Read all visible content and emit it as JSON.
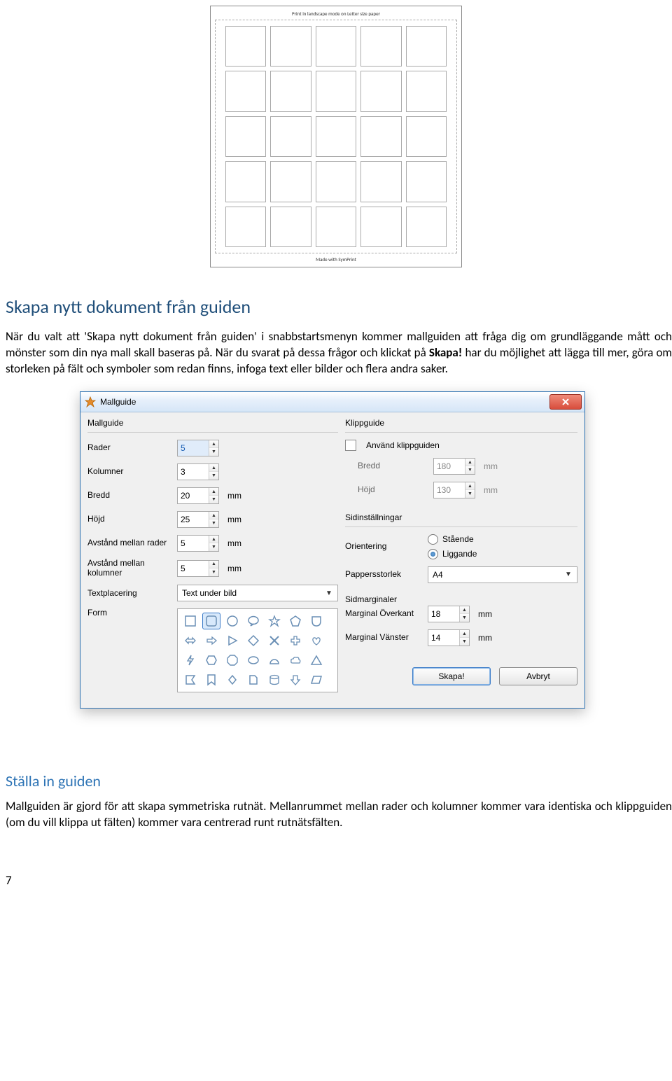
{
  "preview": {
    "header": "Print in landscape mode on Letter size paper",
    "footer": "Made with SymPrint"
  },
  "section1": {
    "heading": "Skapa nytt dokument från guiden",
    "para_before": "När du valt att 'Skapa nytt dokument från guiden' i snabbstartsmenyn kommer mallguiden att fråga dig om grundläggande mått och mönster som din nya mall skall baseras på. När du svarat på dessa frågor och klickat på ",
    "para_bold": "Skapa!",
    "para_after": " har du möjlighet att lägga till mer, göra om storleken på fält och symboler som redan finns, infoga text eller bilder och flera andra saker."
  },
  "dialog": {
    "title": "Mallguide",
    "left": {
      "group": "Mallguide",
      "rows_label": "Rader",
      "rows_value": "5",
      "cols_label": "Kolumner",
      "cols_value": "3",
      "width_label": "Bredd",
      "width_value": "20",
      "height_label": "Höjd",
      "height_value": "25",
      "rowgap_label": "Avstånd mellan rader",
      "rowgap_value": "5",
      "colgap_label": "Avstånd mellan kolumner",
      "colgap_value": "5",
      "textpos_label": "Textplacering",
      "textpos_value": "Text under bild",
      "form_label": "Form",
      "unit_mm": "mm"
    },
    "right": {
      "cut_group": "Klippguide",
      "cut_use_label": "Använd klippguiden",
      "cut_width_label": "Bredd",
      "cut_width_value": "180",
      "cut_height_label": "Höjd",
      "cut_height_value": "130",
      "page_group": "Sidinställningar",
      "orient_label": "Orientering",
      "orient_portrait": "Stående",
      "orient_landscape": "Liggande",
      "paper_label": "Pappersstorlek",
      "paper_value": "A4",
      "margin_group": "Sidmarginaler",
      "margin_top_label": "Marginal Överkant",
      "margin_top_value": "18",
      "margin_left_label": "Marginal Vänster",
      "margin_left_value": "14",
      "unit_mm": "mm"
    },
    "buttons": {
      "create": "Skapa!",
      "cancel": "Avbryt"
    }
  },
  "section2": {
    "heading": "Ställa in guiden",
    "para": "Mallguiden är gjord för att skapa symmetriska rutnät. Mellanrummet mellan rader och kolumner kommer vara identiska och klippguiden (om du vill klippa ut fälten) kommer vara centrerad runt rutnätsfälten."
  },
  "page_number": "7"
}
